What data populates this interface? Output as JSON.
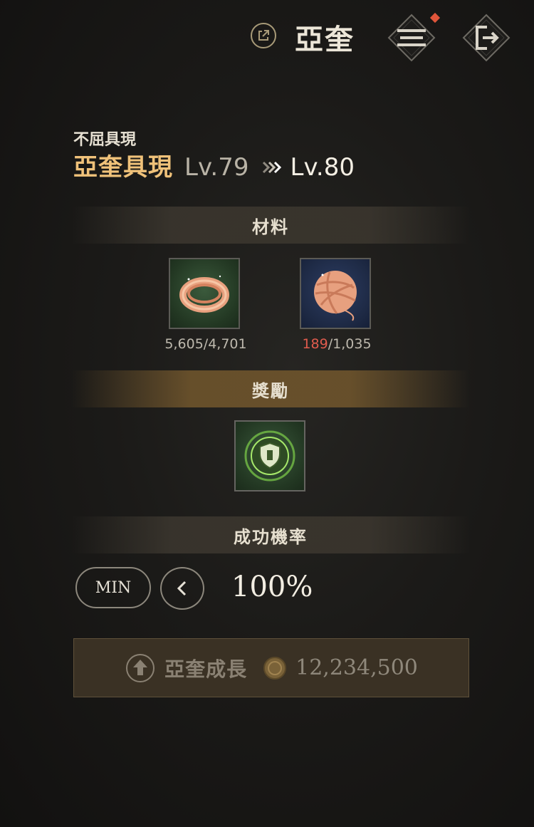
{
  "header": {
    "title": "亞奎",
    "link_icon": "external-link-icon",
    "menu_icon": "hamburger-menu-icon",
    "exit_icon": "exit-icon",
    "notify_color": "#e0553a"
  },
  "upgrade": {
    "subtitle": "不屈具現",
    "name": "亞奎具現",
    "level_from": "Lv.79",
    "level_to": "Lv.80"
  },
  "materials": {
    "heading": "材料",
    "items": [
      {
        "icon": "copper-thread-coil-icon",
        "owned": "5,605",
        "required": "/4,701",
        "sufficient": true
      },
      {
        "icon": "copper-yarn-ball-icon",
        "owned": "189",
        "required": "/1,035",
        "sufficient": false
      }
    ]
  },
  "rewards": {
    "heading": "獎勵",
    "items": [
      {
        "icon": "green-shield-emblem-icon"
      }
    ]
  },
  "success": {
    "heading": "成功機率",
    "min_label": "MIN",
    "rate": "100%"
  },
  "grow_button": {
    "label": "亞奎成長",
    "cost": "12,234,500",
    "currency_icon": "gold-coin-icon"
  }
}
